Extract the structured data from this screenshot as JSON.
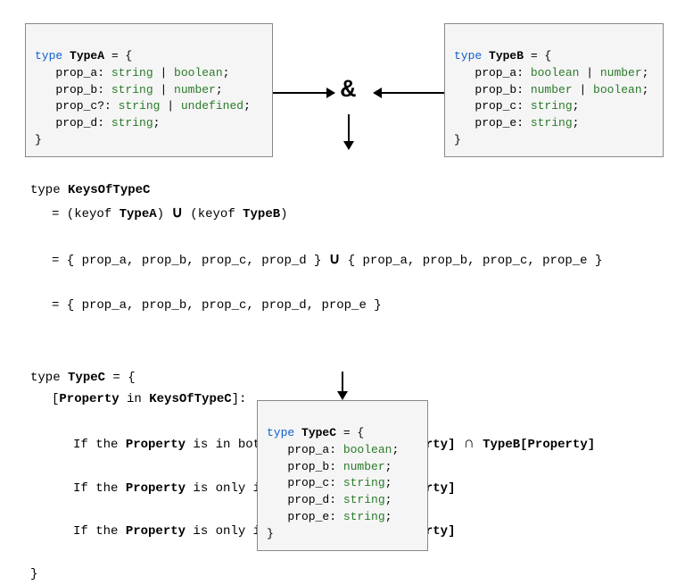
{
  "amp": "&",
  "boxA": {
    "l1_kw": "type",
    "l1_name": " TypeA",
    "l1_rest": " = {",
    "l2_a": "   prop_a: ",
    "l2_t1": "string",
    "l2_b": " | ",
    "l2_t2": "boolean",
    "l2_c": ";",
    "l3_a": "   prop_b: ",
    "l3_t1": "string",
    "l3_b": " | ",
    "l3_t2": "number",
    "l3_c": ";",
    "l4_a": "   prop_c?: ",
    "l4_t1": "string",
    "l4_b": " | ",
    "l4_t2": "undefined",
    "l4_c": ";",
    "l5_a": "   prop_d: ",
    "l5_t1": "string",
    "l5_c": ";",
    "l6": "}"
  },
  "boxB": {
    "l1_kw": "type",
    "l1_name": " TypeB",
    "l1_rest": " = {",
    "l2_a": "   prop_a: ",
    "l2_t1": "boolean",
    "l2_b": " | ",
    "l2_t2": "number",
    "l2_c": ";",
    "l3_a": "   prop_b: ",
    "l3_t1": "number",
    "l3_b": " | ",
    "l3_t2": "boolean",
    "l3_c": ";",
    "l4_a": "   prop_c: ",
    "l4_t1": "string",
    "l4_c": ";",
    "l5_a": "   prop_e: ",
    "l5_t1": "string",
    "l5_c": ";",
    "l6": "}"
  },
  "mid": {
    "k1_a": "type ",
    "k1_b": "KeysOfTypeC",
    "k2_a": "= (keyof ",
    "k2_b": "TypeA",
    "k2_c": ") ",
    "k2_op": "∪",
    "k2_d": " (keyof ",
    "k2_e": "TypeB",
    "k2_f": ")",
    "k3_a": "= { prop_a, prop_b, prop_c, prop_d } ",
    "k3_op": "∪",
    "k3_b": " { prop_a, prop_b, prop_c, prop_e }",
    "k4": "= { prop_a, prop_b, prop_c, prop_d, prop_e }",
    "c1_a": "type ",
    "c1_b": "TypeC",
    "c1_c": " = {",
    "c2_a": "[",
    "c2_b": "Property",
    "c2_c": " in ",
    "c2_d": "KeysOfTypeC",
    "c2_e": "]:",
    "r1_a": "If the ",
    "r1_b": "Property",
    "r1_c": " is in both Types => ",
    "r1_d": "TypeA[Property]",
    "r1_op": " ∩ ",
    "r1_e": "TypeB[Property]",
    "r2_a": "If the ",
    "r2_b": "Property",
    "r2_c": " is only in TypeA => ",
    "r2_d": "TypeA[Property]",
    "r3_a": "If the ",
    "r3_b": "Property",
    "r3_c": " is only in TypeB => ",
    "r3_d": "TypeB[Property]",
    "close": "}"
  },
  "boxC": {
    "l1_kw": "type",
    "l1_name": " TypeC",
    "l1_rest": " = {",
    "l2_a": "   prop_a: ",
    "l2_t": "boolean",
    "l2_c": ";",
    "l3_a": "   prop_b: ",
    "l3_t": "number",
    "l3_c": ";",
    "l4_a": "   prop_c: ",
    "l4_t": "string",
    "l4_c": ";",
    "l5_a": "   prop_d: ",
    "l5_t": "string",
    "l5_c": ";",
    "l6_a": "   prop_e: ",
    "l6_t": "string",
    "l6_c": ";",
    "l7": "}"
  }
}
